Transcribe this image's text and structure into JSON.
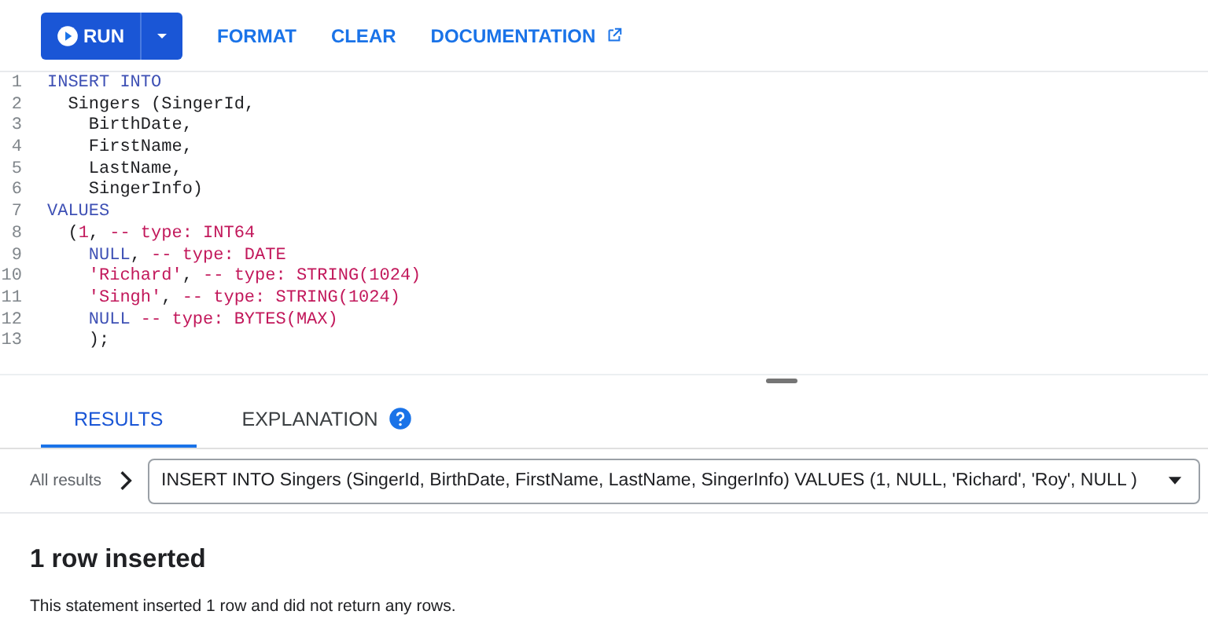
{
  "toolbar": {
    "run_button": "RUN",
    "actions": [
      {
        "label": "FORMAT",
        "kind": "plain"
      },
      {
        "label": "CLEAR",
        "kind": "plain"
      },
      {
        "label": "DOCUMENTATION",
        "kind": "external"
      }
    ]
  },
  "editor": {
    "lines": [
      {
        "number": "1",
        "tokens": [
          {
            "text": "INSERT INTO",
            "kind": "keyword"
          }
        ]
      },
      {
        "number": "2",
        "tokens": [
          {
            "text": "  Singers (SingerId,",
            "kind": "ident"
          }
        ]
      },
      {
        "number": "3",
        "tokens": [
          {
            "text": "    BirthDate,",
            "kind": "ident"
          }
        ]
      },
      {
        "number": "4",
        "tokens": [
          {
            "text": "    FirstName,",
            "kind": "ident"
          }
        ]
      },
      {
        "number": "5",
        "tokens": [
          {
            "text": "    LastName,",
            "kind": "ident"
          }
        ]
      },
      {
        "number": "6",
        "tokens": [
          {
            "text": "    SingerInfo)",
            "kind": "ident"
          }
        ]
      },
      {
        "number": "7",
        "tokens": [
          {
            "text": "VALUES",
            "kind": "keyword"
          }
        ]
      },
      {
        "number": "8",
        "tokens": [
          {
            "text": "  (",
            "kind": "ident"
          },
          {
            "text": "1",
            "kind": "literal"
          },
          {
            "text": ", ",
            "kind": "ident"
          },
          {
            "text": "-- type: INT64",
            "kind": "comment"
          }
        ]
      },
      {
        "number": "9",
        "tokens": [
          {
            "text": "    NULL",
            "kind": "keyword"
          },
          {
            "text": ", ",
            "kind": "ident"
          },
          {
            "text": "-- type: DATE",
            "kind": "comment"
          }
        ]
      },
      {
        "number": "10",
        "tokens": [
          {
            "text": "    'Richard'",
            "kind": "literal"
          },
          {
            "text": ", ",
            "kind": "ident"
          },
          {
            "text": "-- type: STRING(1024)",
            "kind": "comment"
          }
        ]
      },
      {
        "number": "11",
        "tokens": [
          {
            "text": "    'Singh'",
            "kind": "literal"
          },
          {
            "text": ", ",
            "kind": "ident"
          },
          {
            "text": "-- type: STRING(1024)",
            "kind": "comment"
          }
        ]
      },
      {
        "number": "12",
        "tokens": [
          {
            "text": "    NULL ",
            "kind": "keyword"
          },
          {
            "text": "-- type: BYTES(MAX)",
            "kind": "comment"
          }
        ]
      },
      {
        "number": "13",
        "tokens": [
          {
            "text": "    );",
            "kind": "ident"
          }
        ]
      }
    ]
  },
  "result_tabs": [
    {
      "label": "RESULTS",
      "selected": true,
      "help": false
    },
    {
      "label": "EXPLANATION",
      "selected": false,
      "help": true
    }
  ],
  "results_bar": {
    "breadcrumb": "All results",
    "statement": "INSERT INTO Singers (SingerId, BirthDate, FirstName, LastName, SingerInfo) VALUES (1, NULL, 'Richard', 'Roy', NULL )"
  },
  "result": {
    "heading": "1 row inserted",
    "message": "This statement inserted 1 row and did not return any rows."
  }
}
